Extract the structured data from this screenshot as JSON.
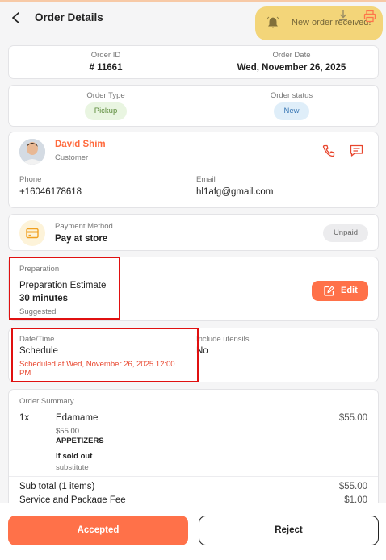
{
  "header": {
    "title": "Order Details"
  },
  "toast": {
    "message": "New order received!"
  },
  "order": {
    "id_label": "Order ID",
    "id_value": "# 11661",
    "date_label": "Order Date",
    "date_value": "Wed, November 26, 2025",
    "type_label": "Order Type",
    "type_value": "Pickup",
    "status_label": "Order status",
    "status_value": "New"
  },
  "customer": {
    "name": "David Shim",
    "role": "Customer",
    "phone_label": "Phone",
    "phone_value": "+16046178618",
    "email_label": "Email",
    "email_value": "hl1afg@gmail.com"
  },
  "payment": {
    "label": "Payment Method",
    "value": "Pay at store",
    "badge": "Unpaid"
  },
  "preparation": {
    "section_label": "Preparation",
    "estimate_label": "Preparation Estimate",
    "estimate_value": "30 minutes",
    "hint": "Suggested",
    "edit_label": "Edit"
  },
  "schedule": {
    "label": "Date/Time",
    "value": "Schedule",
    "detail_line1": "Scheduled at Wed, November 26, 2025 12:00",
    "detail_line2": "PM",
    "utensils_label": "Include utensils",
    "utensils_value": "No"
  },
  "summary": {
    "label": "Order Summary",
    "items": [
      {
        "qty": "1x",
        "name": "Edamame",
        "price": "$55.00",
        "unit_price": "$55.00",
        "category": "APPETIZERS",
        "sold_out_label": "If sold out",
        "sold_out_value": "substitute"
      }
    ],
    "subtotal_label": "Sub total (1 items)",
    "subtotal_value": "$55.00",
    "fee_label": "Service and Package Fee",
    "fee_value": "$1.00"
  },
  "actions": {
    "accept": "Accepted",
    "reject": "Reject"
  },
  "colors": {
    "accent": "#ff7149",
    "highlight": "#e01010",
    "toast": "#f3d36f"
  }
}
